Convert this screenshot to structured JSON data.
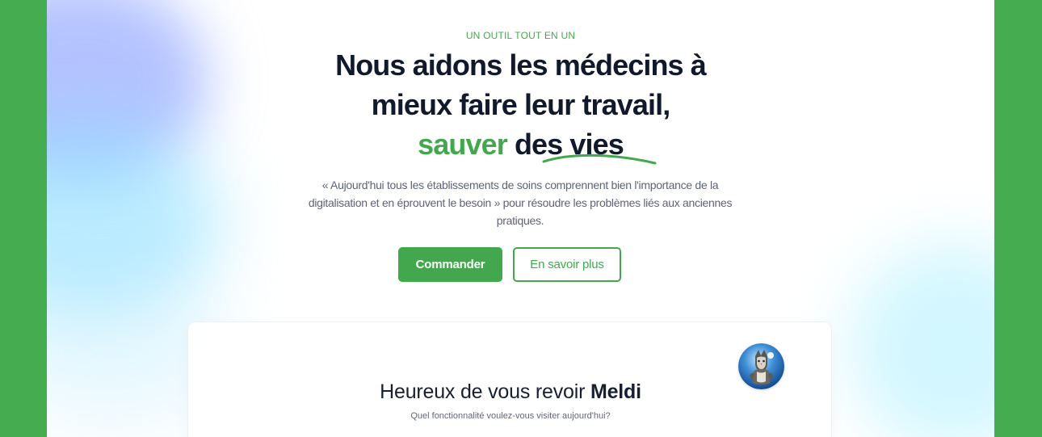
{
  "hero": {
    "eyebrow": "UN OUTIL TOUT EN UN",
    "headline_line_1": "Nous aidons les médecins à",
    "headline_line_2": "mieux faire leur travail,",
    "headline_highlight": "sauver",
    "headline_tail_prefix": "de",
    "headline_tail_underlined": "s vies",
    "lead": "« Aujourd'hui tous les établissements de soins comprennent bien l'importance de la digitalisation et en éprouvent le besoin » pour résoudre les problèmes liés aux anciennes pratiques."
  },
  "actions": {
    "primary_label": "Commander",
    "secondary_label": "En savoir plus"
  },
  "welcome_card": {
    "greeting_prefix": "Heureux de vous revoir",
    "user_name": "Meldi",
    "subtitle": "Quel fonctionnalité voulez-vous visiter aujourd'hui?",
    "avatar_icon": "cat-avatar-icon"
  },
  "colors": {
    "brand_green": "#43a84d",
    "dark_text": "#101a2c",
    "page_background": "#ffffff",
    "outer_frame": "#45ad4f"
  }
}
